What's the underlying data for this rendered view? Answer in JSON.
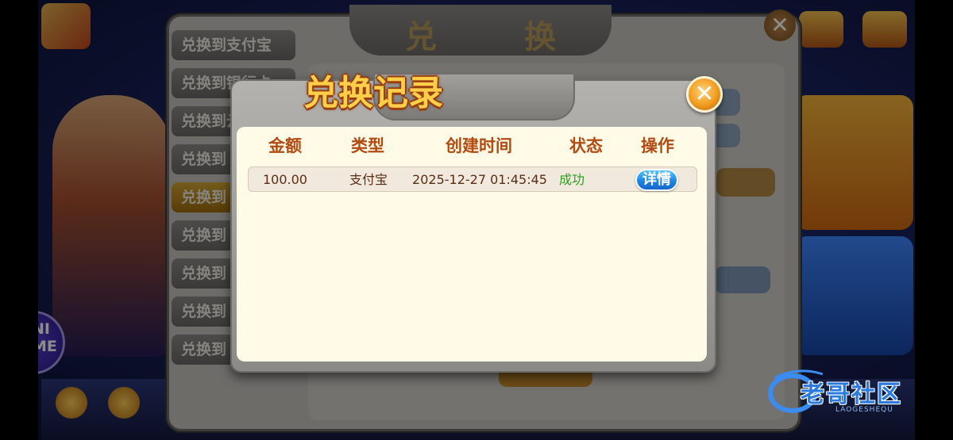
{
  "background": {
    "exchange_panel": {
      "title": "兑 换",
      "tabs": [
        "兑换到支付宝",
        "兑换到银行卡",
        "兑换到云闪付",
        "兑换到",
        "兑换到",
        "兑换到",
        "兑换到",
        "兑换到",
        "兑换到"
      ],
      "active_tab_index": 4
    },
    "mini_game": "NI\nME"
  },
  "record_dialog": {
    "title": "兑换记录",
    "columns": [
      "金额",
      "类型",
      "创建时间",
      "状态",
      "操作"
    ],
    "rows": [
      {
        "amount": "100.00",
        "type": "支付宝",
        "created": "2025-12-27 01:45:45",
        "status": "成功",
        "action": "详情"
      }
    ]
  },
  "watermark": {
    "title": "老哥社区",
    "subtitle": "LAOGESHEQU"
  },
  "colors": {
    "header_text": "#b24a12",
    "status_success": "#2f9e1e",
    "detail_button": "#1f86e6",
    "title_gold": "#ffcf4a"
  }
}
